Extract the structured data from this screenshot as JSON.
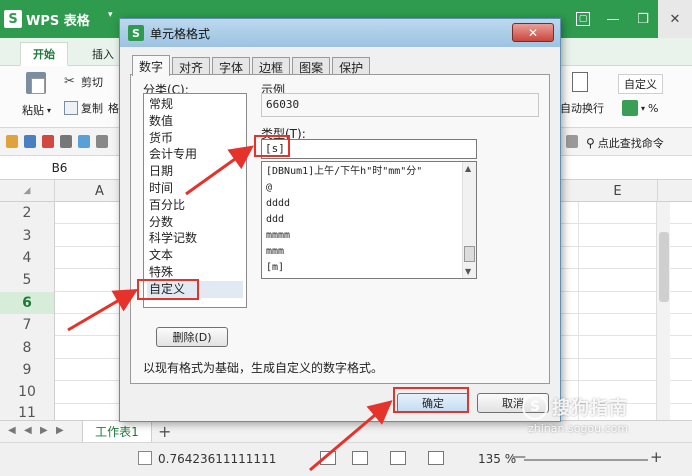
{
  "app": {
    "title": "WPS 表格",
    "logo_letter": "S",
    "dropdown_glyph": "▾",
    "window_controls": [
      "▢",
      "—",
      "❐"
    ],
    "close_glyph": "✕"
  },
  "ribbon_tabs": [
    "开始",
    "插入"
  ],
  "ribbon": {
    "paste_label": "粘贴",
    "cut_label": "剪切",
    "copy_label": "复制",
    "format_label": "格",
    "custom_label": "自定义",
    "auto_wrap_label": "自动换行",
    "percent_glyph": "%"
  },
  "quickbar": {
    "search_label": "点此查找命令"
  },
  "name_box": "B6",
  "columns": [
    "A",
    "E"
  ],
  "rows": [
    "2",
    "3",
    "4",
    "5",
    "6",
    "7",
    "8",
    "9",
    "10",
    "11"
  ],
  "active_row": "6",
  "sheet": {
    "tab_label": "工作表1",
    "add_glyph": "+",
    "nav_glyphs": [
      "◀",
      "◀",
      "▶",
      "▶"
    ]
  },
  "status": {
    "value": "0.76423611111111",
    "zoom": "135 %",
    "zoom_minus": "—",
    "zoom_plus": "+"
  },
  "dialog": {
    "title": "单元格格式",
    "icon_letter": "S",
    "close_glyph": "✕",
    "tabs": [
      "数字",
      "对齐",
      "字体",
      "边框",
      "图案",
      "保护"
    ],
    "active_tab": "数字",
    "category_label": "分类(C):",
    "categories": [
      "常规",
      "数值",
      "货币",
      "会计专用",
      "日期",
      "时间",
      "百分比",
      "分数",
      "科学记数",
      "文本",
      "特殊",
      "自定义"
    ],
    "selected_category": "自定义",
    "sample_label": "示例",
    "sample_value": "66030",
    "type_label": "类型(T):",
    "type_value": "[s]",
    "type_options": [
      "[DBNum1]上午/下午h\"时\"mm\"分\"",
      "@",
      "dddd",
      "ddd",
      "mmmm",
      "mmm",
      "[m]"
    ],
    "delete_label": "删除(D)",
    "description": "以现有格式为基础，生成自定义的数字格式。",
    "ok_label": "确定",
    "cancel_label": "取消"
  },
  "watermark": {
    "logo_letter": "S",
    "title": "搜狗指南",
    "url": "zhinan.sogou.com"
  },
  "colors": {
    "wps_green": "#2e9b4e",
    "annotation_red": "#e5322b",
    "dialog_title_blue": "#9dc3e2"
  },
  "icons": [
    "paste-icon",
    "cut-icon",
    "copy-icon",
    "save-icon",
    "print-icon",
    "search-icon",
    "close-icon",
    "arrow-annotation"
  ]
}
